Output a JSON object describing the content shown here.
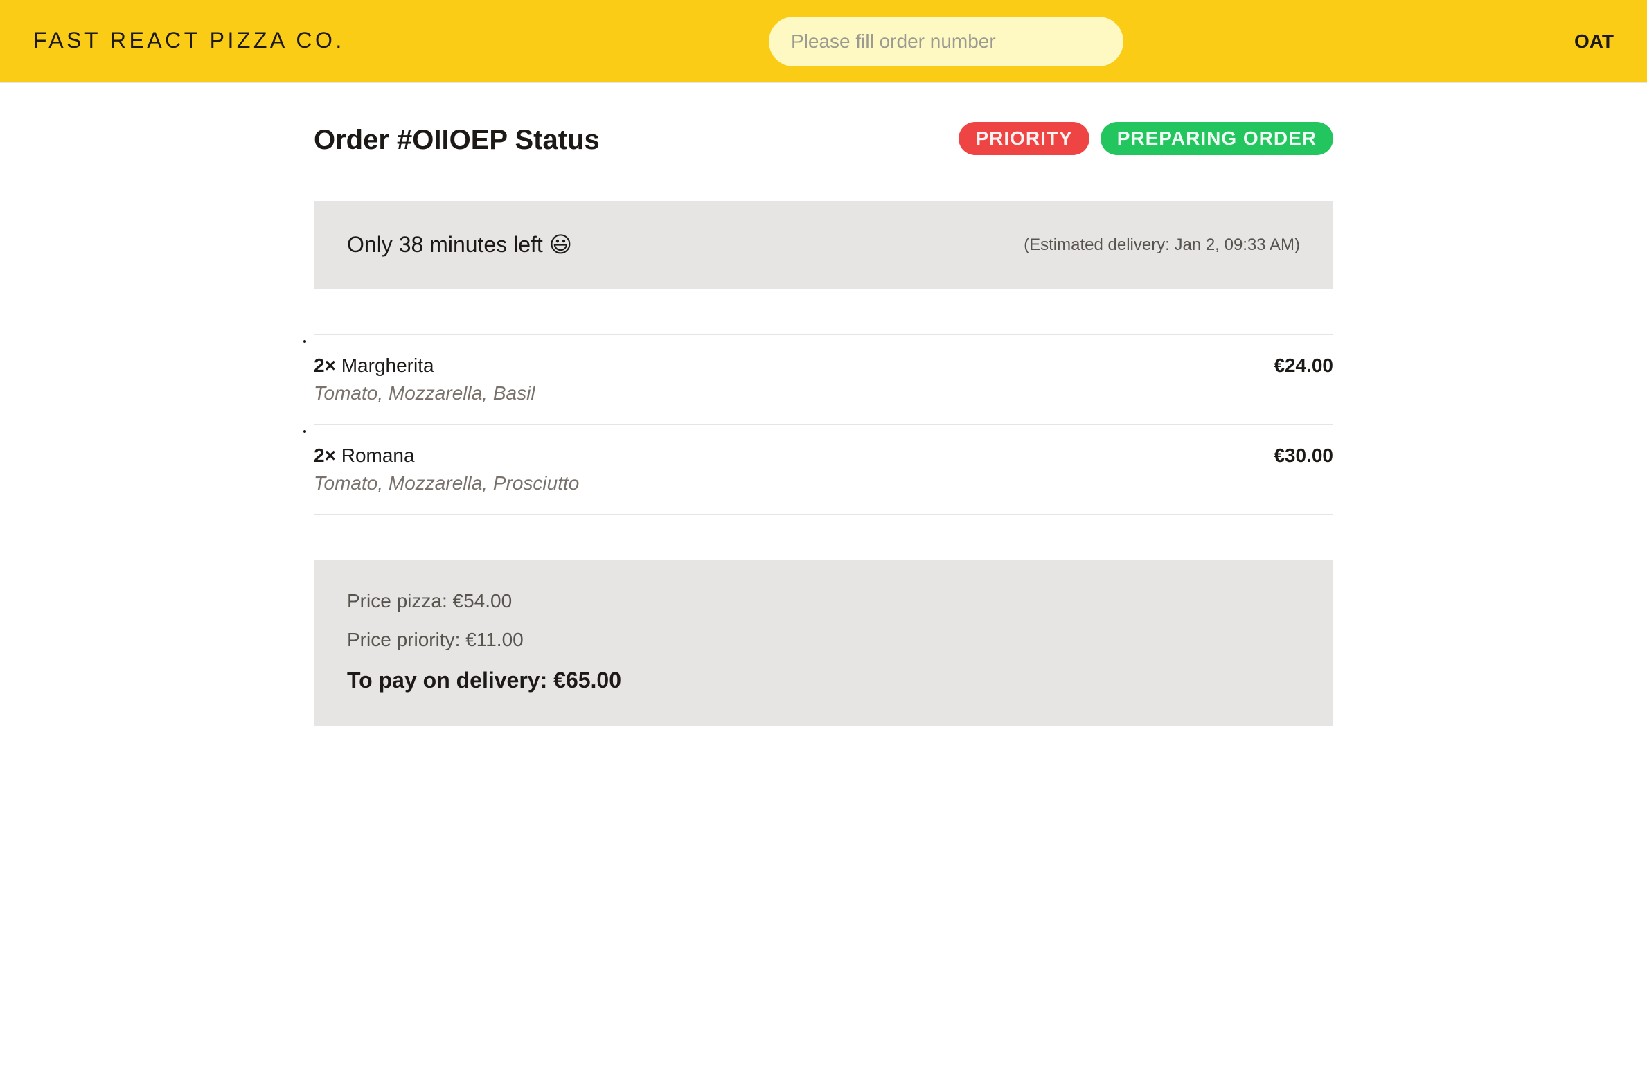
{
  "header": {
    "logo": "FAST REACT PIZZA CO.",
    "search_placeholder": "Please fill order number",
    "username": "OAT"
  },
  "order": {
    "title": "Order #OIIOEP Status",
    "badges": {
      "priority": "PRIORITY",
      "status": "PREPARING ORDER"
    },
    "eta": {
      "remaining": "Only 38 minutes left 😃",
      "estimated": "(Estimated delivery: Jan 2, 09:33 AM)"
    },
    "items": [
      {
        "quantity": "2×",
        "name": "Margherita",
        "ingredients": "Tomato, Mozzarella, Basil",
        "price": "€24.00"
      },
      {
        "quantity": "2×",
        "name": "Romana",
        "ingredients": "Tomato, Mozzarella, Prosciutto",
        "price": "€30.00"
      }
    ],
    "summary": {
      "price_pizza": "Price pizza: €54.00",
      "price_priority": "Price priority: €11.00",
      "total": "To pay on delivery: €65.00"
    }
  },
  "colors": {
    "header_bg": "#facc15",
    "search_bg": "#fef9c3",
    "priority_badge": "#ef4444",
    "status_badge": "#22c55e",
    "panel_bg": "#e7e5e4"
  }
}
